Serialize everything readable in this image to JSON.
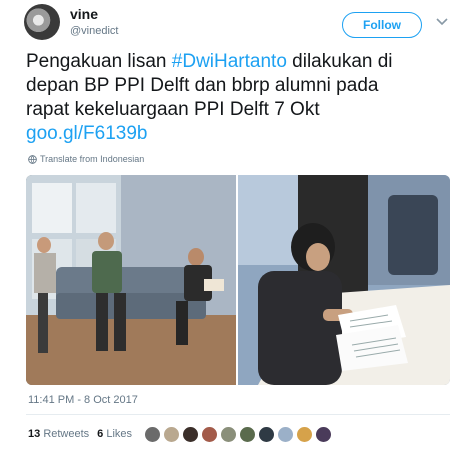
{
  "author": {
    "display_name": "vine",
    "handle": "@vinedict"
  },
  "follow_label": "Follow",
  "tweet": {
    "line1_prefix": "Pengakuan lisan ",
    "hashtag": "#DwiHartanto",
    "line1_suffix": " dilakukan di",
    "line2": "depan BP PPI Delft dan bbrp alumni pada",
    "line3": "rapat kekeluargaan PPI Delft 7 Okt",
    "link": "goo.gl/F6139b"
  },
  "translate_label": "Translate from Indonesian",
  "timestamp": "11:41 PM - 8 Oct 2017",
  "stats": {
    "retweets_count": "13",
    "retweets_label": "Retweets",
    "likes_count": "6",
    "likes_label": "Likes"
  },
  "liker_avatar_colors": [
    "#6b6b6b",
    "#b9a88f",
    "#3b2f2a",
    "#a35b4a",
    "#8a8f7a",
    "#5a6b4d",
    "#2f3a44",
    "#9bb0c8",
    "#d6a24a",
    "#4a3b5a"
  ],
  "colors": {
    "accent": "#1da1f2",
    "text": "#14171a",
    "secondary": "#657786",
    "border": "#e6ecf0"
  }
}
